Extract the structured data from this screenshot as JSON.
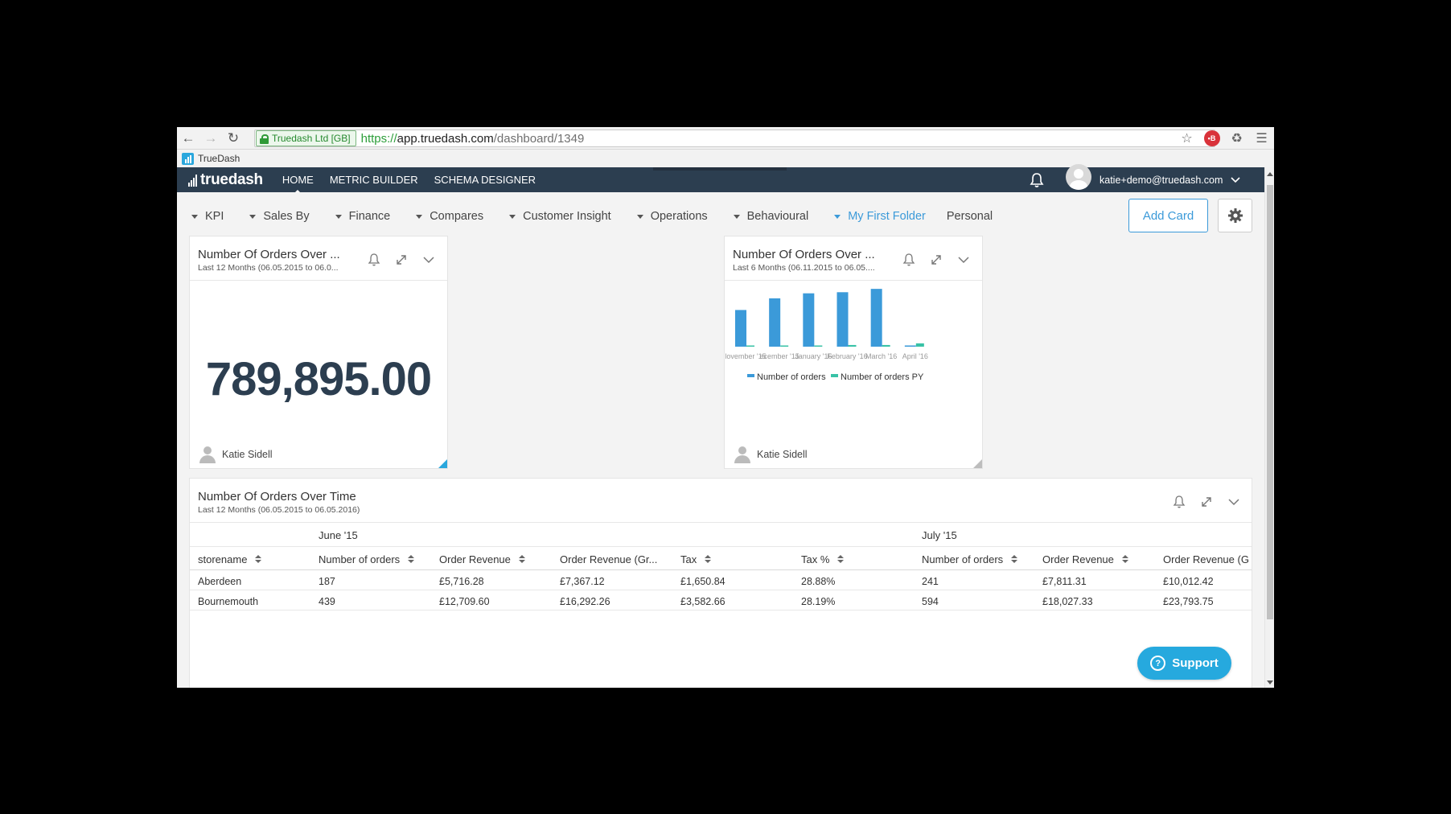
{
  "browser": {
    "security_label": "Truedash Ltd [GB]",
    "url_scheme": "https://",
    "url_host": "app.truedash.com",
    "url_path": "/dashboard/1349",
    "bookmark_label": "TrueDash",
    "extension_badge": "•B"
  },
  "app": {
    "logo": "truedash",
    "nav": [
      "HOME",
      "METRIC BUILDER",
      "SCHEMA DESIGNER"
    ],
    "active_nav": "HOME",
    "user_email": "katie+demo@truedash.com"
  },
  "folders": [
    {
      "label": "KPI",
      "color": "#444444"
    },
    {
      "label": "Sales By",
      "color": "#444444"
    },
    {
      "label": "Finance",
      "color": "#444444"
    },
    {
      "label": "Compares",
      "color": "#444444"
    },
    {
      "label": "Customer Insight",
      "color": "#444444"
    },
    {
      "label": "Operations",
      "color": "#444444"
    },
    {
      "label": "Behavioural",
      "color": "#444444"
    },
    {
      "label": "My First Folder",
      "color": "#3b9ad9"
    }
  ],
  "personal_label": "Personal",
  "add_card_label": "Add Card",
  "kpi_card": {
    "title": "Number Of Orders Over ...",
    "subtitle": "Last 12 Months (06.05.2015 to 06.0...",
    "value": "789,895.00",
    "author": "Katie Sidell"
  },
  "chart_card": {
    "title": "Number Of Orders Over ...",
    "subtitle": "Last 6 Months (06.11.2015 to 06.05....",
    "author": "Katie Sidell"
  },
  "chart_data": {
    "type": "bar",
    "categories": [
      "November '15",
      "December '15",
      "January '16",
      "February '16",
      "March '16",
      "April '16"
    ],
    "category_labels": [
      "lovember '15",
      "ecember '15",
      "January '16",
      "February '16",
      "March '16",
      "April '16"
    ],
    "series": [
      {
        "name": "Number of orders",
        "color": "#3b9ad9",
        "values": [
          66,
          87,
          96,
          98,
          104,
          2
        ]
      },
      {
        "name": "Number of orders PY",
        "color": "#38c2a6",
        "values": [
          2,
          2,
          2,
          3,
          3,
          6
        ]
      }
    ],
    "legend_position": "bottom",
    "grid": false,
    "ylim": [
      0,
      110
    ]
  },
  "table_card": {
    "title": "Number Of Orders Over Time",
    "subtitle": "Last 12 Months (06.05.2015 to 06.05.2016)",
    "groups": [
      "June '15",
      "July '15"
    ],
    "columns": [
      "storename",
      "Number of orders",
      "Order Revenue",
      "Order Revenue (Gr...",
      "Tax",
      "Tax %",
      "Number of orders",
      "Order Revenue",
      "Order Revenue (G"
    ],
    "rows": [
      [
        "Aberdeen",
        "187",
        "£5,716.28",
        "£7,367.12",
        "£1,650.84",
        "28.88%",
        "241",
        "£7,811.31",
        "£10,012.42"
      ],
      [
        "Bournemouth",
        "439",
        "£12,709.60",
        "£16,292.26",
        "£3,582.66",
        "28.19%",
        "594",
        "£18,027.33",
        "£23,793.75"
      ]
    ]
  },
  "support_label": "Support"
}
